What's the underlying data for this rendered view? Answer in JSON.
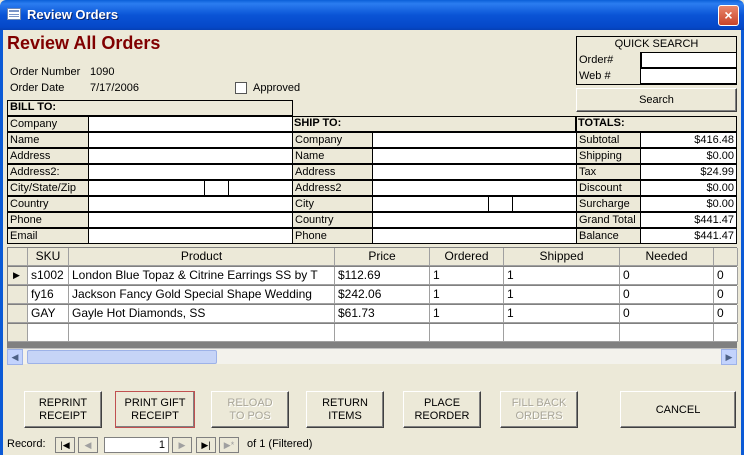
{
  "window": {
    "title": "Review Orders",
    "close_glyph": "×"
  },
  "page_title": "Review All Orders",
  "order": {
    "number_label": "Order Number",
    "number": "1090",
    "date_label": "Order Date",
    "date": "7/17/2006",
    "approved_label": "Approved",
    "approved": false
  },
  "quick_search": {
    "title": "QUICK SEARCH",
    "order_label": "Order#",
    "order_value": "",
    "web_label": "Web #",
    "web_value": "",
    "button": "Search"
  },
  "bill_to": {
    "header": "BILL TO:",
    "labels": [
      "Company",
      "Name",
      "Address",
      "Address2:",
      "City/State/Zip",
      "Country",
      "Phone",
      "Email"
    ]
  },
  "ship_to": {
    "header": "SHIP TO:",
    "labels": [
      "Company",
      "Name",
      "Address",
      "Address2",
      "City",
      "Country",
      "Phone"
    ]
  },
  "totals": {
    "header": "TOTALS:",
    "rows": [
      {
        "label": "Subtotal",
        "value": "$416.48"
      },
      {
        "label": "Shipping",
        "value": "$0.00"
      },
      {
        "label": "Tax",
        "value": "$24.99"
      },
      {
        "label": "Discount",
        "value": "$0.00"
      },
      {
        "label": "Surcharge",
        "value": "$0.00"
      },
      {
        "label": "Grand Total",
        "value": "$441.47"
      },
      {
        "label": "Balance",
        "value": "$441.47"
      }
    ]
  },
  "items": {
    "columns": [
      "SKU",
      "Product",
      "Price",
      "Ordered",
      "Shipped",
      "Needed",
      ""
    ],
    "rows": [
      {
        "sku": "s1002",
        "product": "London Blue Topaz & Citrine Earrings SS by T",
        "price": "$112.69",
        "ordered": "1",
        "shipped": "1",
        "needed": "0",
        "extra": "0"
      },
      {
        "sku": "fy16",
        "product": "Jackson Fancy Gold Special Shape Wedding",
        "price": "$242.06",
        "ordered": "1",
        "shipped": "1",
        "needed": "0",
        "extra": "0"
      },
      {
        "sku": "GAY",
        "product": "Gayle Hot Diamonds, SS",
        "price": "$61.73",
        "ordered": "1",
        "shipped": "1",
        "needed": "0",
        "extra": "0"
      }
    ],
    "current_row_marker": "▶"
  },
  "buttons": {
    "reprint_receipt": "REPRINT RECEIPT",
    "print_gift_receipt": "PRINT GIFT RECEIPT",
    "reload_to_pos": "RELOAD TO POS",
    "return_items": "RETURN ITEMS",
    "place_reorder": "PLACE REORDER",
    "fill_back_orders": "FILL BACK ORDERS",
    "cancel": "CANCEL"
  },
  "record_nav": {
    "label": "Record:",
    "current": "1",
    "of_text": "of  1 (Filtered)"
  },
  "icons": [
    "form-icon",
    "close-icon",
    "first-record-icon",
    "prev-record-icon",
    "next-record-icon",
    "last-record-icon",
    "new-record-icon",
    "scroll-left-icon",
    "scroll-right-icon",
    "row-selector-icon"
  ]
}
